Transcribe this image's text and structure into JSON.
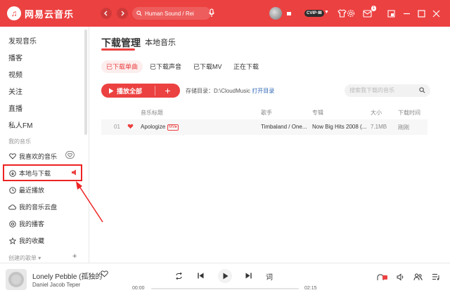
{
  "app": {
    "logo_text": "网易云音乐",
    "logo_glyph": "♫"
  },
  "titlebar": {
    "search_placeholder": "Human Sound / Rei",
    "vip_label": "CVIP·Ⅲ",
    "message_count": "1"
  },
  "sidebar": {
    "top_items": [
      "发现音乐",
      "播客",
      "视频",
      "关注",
      "直播",
      "私人FM"
    ],
    "my_music_label": "我的音乐",
    "liked": "我喜欢的音乐",
    "local_download": "本地与下载",
    "recent": "最近播放",
    "cloud": "我的音乐云盘",
    "podcast": "我的播客",
    "collect": "我的收藏",
    "created_playlists": "创建的歌单",
    "add_glyph": "+"
  },
  "main": {
    "tab_download": "下载管理",
    "tab_local": "本地音乐",
    "subtabs": [
      "已下载单曲",
      "已下载声音",
      "已下载MV",
      "正在下载"
    ],
    "play_all": "播放全部",
    "storage_label": "存储目录：D:\\CloudMusic",
    "open_dir": "打开目录",
    "local_search_placeholder": "搜索我下载的音乐",
    "columns": {
      "title": "音乐标题",
      "artist": "歌手",
      "album": "专辑",
      "size": "大小",
      "time": "下载时间"
    },
    "rows": [
      {
        "index": "01",
        "title": "Apologize",
        "mv": "MV▸",
        "artist": "Timbaland / One...",
        "album": "Now Big Hits 2008 (...",
        "size": "7.1MB",
        "time": "刚刚"
      }
    ]
  },
  "player": {
    "title": "Lonely Pebble (孤独的",
    "artist": "Daniel Jacob Teper",
    "time_current": "00:00",
    "time_total": "02:15",
    "progress": 0,
    "lyrics_glyph": "词"
  },
  "colors": {
    "accent": "#ec4141",
    "link": "#2f66b5"
  }
}
